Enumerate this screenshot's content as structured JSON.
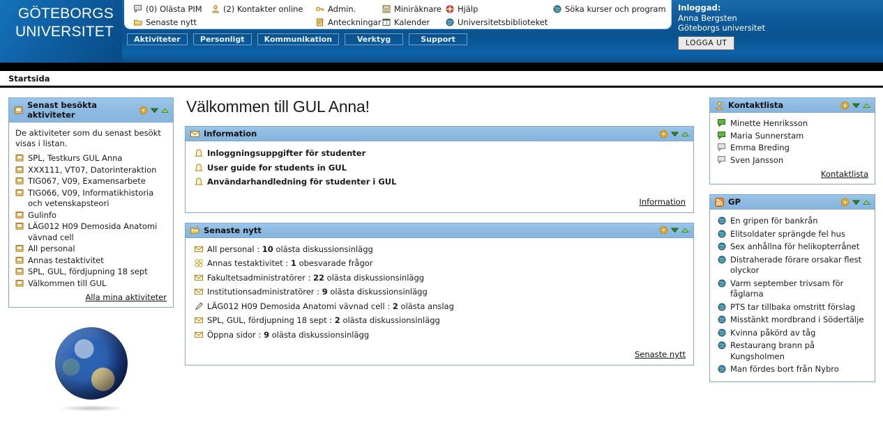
{
  "header": {
    "logo_line1": "GÖTEBORGS",
    "logo_line2": "UNIVERSITET",
    "quicklinks": {
      "col1": [
        {
          "icon": "speech-bubble-icon",
          "label": "(0) Olästa PIM"
        },
        {
          "icon": "news-folder-icon",
          "label": "Senaste nytt"
        }
      ],
      "col2": [
        {
          "icon": "person-icon",
          "label": "(2) Kontakter online"
        }
      ],
      "col3": [
        {
          "icon": "key-icon",
          "label": "Admin."
        },
        {
          "icon": "notes-icon",
          "label": "Anteckningar"
        }
      ],
      "col4": [
        {
          "icon": "calculator-icon",
          "label": "Miniräknare"
        },
        {
          "icon": "calendar-icon",
          "label": "Kalender"
        }
      ],
      "col5": [
        {
          "icon": "lifebuoy-icon",
          "label": "Hjälp"
        },
        {
          "icon": "globe-icon",
          "label": "Universitetsbiblioteket"
        }
      ],
      "col6": [
        {
          "icon": "globe-icon",
          "label": "Söka kurser och program"
        }
      ]
    },
    "navtabs": [
      {
        "label": "Aktiviteter"
      },
      {
        "label": "Personligt"
      },
      {
        "label": "Kommunikation"
      },
      {
        "label": "Verktyg"
      },
      {
        "label": "Support"
      }
    ],
    "logged_in": {
      "title": "Inloggad:",
      "name": "Anna Bergsten",
      "org": "Göteborgs universitet",
      "logout_label": "LOGGA UT"
    }
  },
  "breadcrumb": {
    "label": "Startsida"
  },
  "main": {
    "welcome_heading": "Välkommen till GUL Anna!",
    "information": {
      "title": "Information",
      "icon": "envelope-icon",
      "items": [
        {
          "icon": "bell-icon",
          "label": "Inloggningsuppgifter för studenter"
        },
        {
          "icon": "bell-icon",
          "label": "User guide for students in GUL"
        },
        {
          "icon": "bell-icon",
          "label": "Användarhandledning för studenter i GUL"
        }
      ],
      "footer_link": "Information"
    },
    "latest_news": {
      "title": "Senaste nytt",
      "icon": "news-folder-icon",
      "items": [
        {
          "icon": "envelope-icon",
          "name": "All personal",
          "count": "10",
          "desc": "olästa diskussionsinlägg"
        },
        {
          "icon": "question-icon",
          "name": "Annas testaktivitet",
          "count": "1",
          "desc": "obesvarade frågor"
        },
        {
          "icon": "envelope-icon",
          "name": "Fakultetsadministratörer",
          "count": "22",
          "desc": "olästa diskussionsinlägg"
        },
        {
          "icon": "envelope-icon",
          "name": "Institutionsadministratörer",
          "count": "9",
          "desc": "olästa diskussionsinlägg"
        },
        {
          "icon": "pin-icon",
          "name": "LÄG012 H09 Demosida Anatomi vävnad cell",
          "count": "2",
          "desc": "olästa anslag"
        },
        {
          "icon": "envelope-icon",
          "name": "SPL, GUL, fördjupning 18 sept",
          "count": "2",
          "desc": "olästa diskussionsinlägg"
        },
        {
          "icon": "envelope-icon",
          "name": "Öppna sidor",
          "count": "9",
          "desc": "olästa diskussionsinlägg"
        }
      ],
      "footer_link": "Senaste nytt"
    }
  },
  "sidebar_left": {
    "recent": {
      "title": "Senast besökta aktiviteter",
      "icon": "book-icon",
      "intro": "De aktiviteter som du senast besökt visas i listan.",
      "items": [
        {
          "icon": "book-icon",
          "label": "SPL, Testkurs GUL Anna"
        },
        {
          "icon": "book-icon",
          "label": "XXX111, VT07, Datorinteraktion"
        },
        {
          "icon": "book-icon",
          "label": "TIG067, V09, Examensarbete"
        },
        {
          "icon": "book-icon",
          "label": "TIG066, V09, Informatikhistoria och vetenskapsteori"
        },
        {
          "icon": "book-icon",
          "label": "Gulinfo"
        },
        {
          "icon": "book-icon",
          "label": "LÄG012 H09 Demosida Anatomi vävnad cell"
        },
        {
          "icon": "book-icon",
          "label": "All personal"
        },
        {
          "icon": "book-icon",
          "label": "Annas testaktivitet"
        },
        {
          "icon": "book-icon",
          "label": "SPL, GUL, fördjupning 18 sept"
        },
        {
          "icon": "book-icon",
          "label": "Välkommen till GUL"
        }
      ],
      "footer_link": "Alla mina aktiviteter"
    },
    "globe_image": "earth-globe-image"
  },
  "sidebar_right": {
    "contacts": {
      "title": "Kontaktlista",
      "icon": "person-icon",
      "items": [
        {
          "icon": "speech-bubble-online-icon",
          "label": "Minette Henriksson",
          "online": true
        },
        {
          "icon": "speech-bubble-online-icon",
          "label": "Maria Sunnerstam",
          "online": true
        },
        {
          "icon": "speech-bubble-icon",
          "label": "Emma Breding",
          "online": false
        },
        {
          "icon": "speech-bubble-icon",
          "label": "Sven Jansson",
          "online": false
        }
      ],
      "footer_link": "Kontaktlista"
    },
    "gp": {
      "title": "GP",
      "icon": "rss-icon",
      "items": [
        {
          "icon": "globe-icon",
          "label": "En gripen för bankrån"
        },
        {
          "icon": "globe-icon",
          "label": "Elitsoldater sprängde fel hus"
        },
        {
          "icon": "globe-icon",
          "label": "Sex anhållna för helikopterrånet"
        },
        {
          "icon": "globe-icon",
          "label": "Distraherade förare orsakar flest olyckor"
        },
        {
          "icon": "globe-icon",
          "label": "Varm september trivsam för fåglarna"
        },
        {
          "icon": "globe-icon",
          "label": "PTS tar tillbaka omstritt förslag"
        },
        {
          "icon": "globe-icon",
          "label": "Misstänkt mordbrand i Södertälje"
        },
        {
          "icon": "globe-icon",
          "label": "Kvinna påkörd av tåg"
        },
        {
          "icon": "globe-icon",
          "label": "Restaurang brann på Kungsholmen"
        },
        {
          "icon": "globe-icon",
          "label": "Man fördes bort från Nybro"
        }
      ]
    }
  },
  "colors": {
    "header_blue": "#0a5494",
    "panel_header_blue": "#8ebae2",
    "panel_border": "#7aa9d0",
    "icon_gold": "#e8a81c",
    "accent_green": "#4a9c22"
  }
}
